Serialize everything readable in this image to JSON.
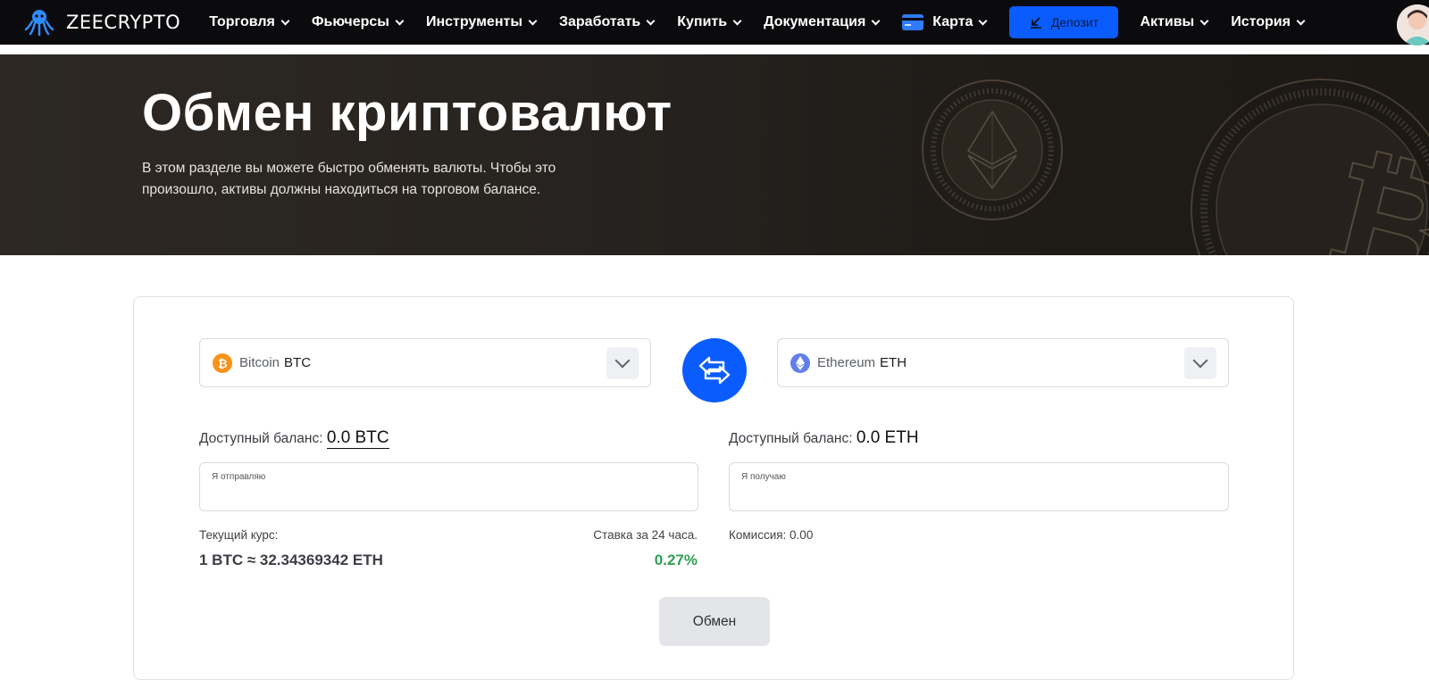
{
  "brand": {
    "name": "ZEECRYPTO"
  },
  "nav": {
    "items": [
      {
        "label": "Торговля"
      },
      {
        "label": "Фьючерсы"
      },
      {
        "label": "Инструменты"
      },
      {
        "label": "Заработать"
      },
      {
        "label": "Купить"
      },
      {
        "label": "Документация"
      },
      {
        "label": "Карта"
      }
    ],
    "deposit_label": "Депозит",
    "right_items": [
      {
        "label": "Активы"
      },
      {
        "label": "История"
      }
    ]
  },
  "hero": {
    "title": "Обмен криптовалют",
    "text": "В этом разделе вы можете быстро обменять валюты. Чтобы это произошло, активы должны находиться на торговом балансе."
  },
  "exchange": {
    "from": {
      "name": "Bitcoin",
      "symbol": "BTC",
      "icon": "bitcoin-icon",
      "color": "#f7931a"
    },
    "to": {
      "name": "Ethereum",
      "symbol": "ETH",
      "icon": "ethereum-icon",
      "color": "#627eea"
    },
    "balance_label": "Доступный баланс:",
    "from_balance": "0.0 BTC",
    "to_balance": "0.0 ETH",
    "send_placeholder": "Я отправляю",
    "receive_placeholder": "Я получаю",
    "rate_label": "Текущий курс:",
    "rate_value": "1 BTC ≈ 32.34369342 ETH",
    "change_label": "Ставка за 24 часа.",
    "change_value": "0.27%",
    "fee_text": "Комиссия: 0.00",
    "submit_label": "Обмен"
  },
  "colors": {
    "accent": "#0b5cff",
    "positive": "#2fa052",
    "nav_bg": "#0b0b0e"
  }
}
